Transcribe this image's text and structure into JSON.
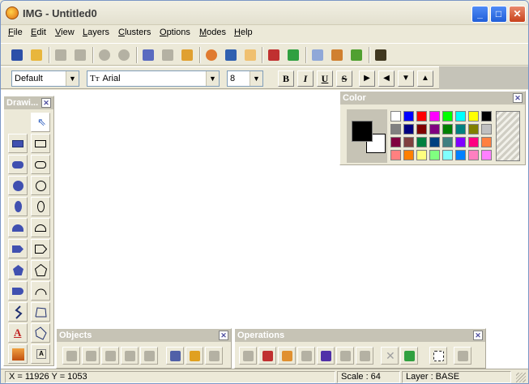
{
  "window": {
    "title": "IMG - Untitled0",
    "minimize": "_",
    "maximize": "□",
    "close": "✕"
  },
  "menu": [
    {
      "pre": "",
      "u": "F",
      "post": "ile"
    },
    {
      "pre": "",
      "u": "E",
      "post": "dit"
    },
    {
      "pre": "",
      "u": "V",
      "post": "iew"
    },
    {
      "pre": "",
      "u": "L",
      "post": "ayers"
    },
    {
      "pre": "",
      "u": "C",
      "post": "lusters"
    },
    {
      "pre": "",
      "u": "O",
      "post": "ptions"
    },
    {
      "pre": "",
      "u": "M",
      "post": "odes"
    },
    {
      "pre": "",
      "u": "H",
      "post": "elp"
    }
  ],
  "format_bar": {
    "style_value": "Default",
    "font_prefix": "Tт",
    "font_value": "Arial",
    "size_value": "8",
    "bold": "B",
    "italic": "I",
    "underline": "U",
    "strike": "S"
  },
  "panels": {
    "drawing": {
      "title": "Drawi...",
      "close": "✕"
    },
    "color": {
      "title": "Color",
      "close": "✕"
    },
    "objects": {
      "title": "Objects",
      "close": "✕"
    },
    "operations": {
      "title": "Operations",
      "close": "✕"
    }
  },
  "palette": [
    "#ffffff",
    "#0000ff",
    "#ff0000",
    "#ff00ff",
    "#00ff00",
    "#00ffff",
    "#ffff00",
    "#000000",
    "#808080",
    "#000080",
    "#800000",
    "#800080",
    "#008000",
    "#008080",
    "#808000",
    "#c0c0c0",
    "#800040",
    "#804040",
    "#008040",
    "#004080",
    "#408080",
    "#8000ff",
    "#ff0080",
    "#ff8040",
    "#ff8080",
    "#ff8000",
    "#ffff80",
    "#80ff80",
    "#80ffff",
    "#0080ff",
    "#ff80c0",
    "#ff80ff"
  ],
  "colors": {
    "foreground": "#000000",
    "background": "#ffffff"
  },
  "status": {
    "coords": "X = 11926  Y = 1053",
    "scale": "Scale :  64",
    "layer": "Layer : BASE"
  }
}
